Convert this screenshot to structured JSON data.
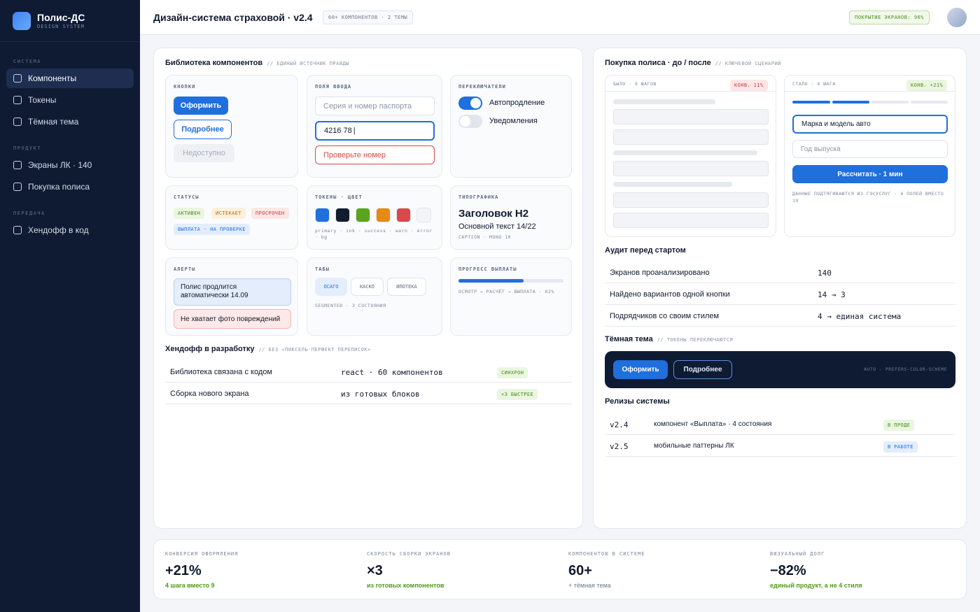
{
  "brand": {
    "name": "Полис-ДС",
    "subtitle": "DESIGN SYSTEM"
  },
  "sidebar": {
    "sections": [
      {
        "title": "СИСТЕМА",
        "items": [
          {
            "label": "Компоненты",
            "active": true
          },
          {
            "label": "Токены"
          },
          {
            "label": "Тёмная тема"
          }
        ]
      },
      {
        "title": "ПРОДУКТ",
        "items": [
          {
            "label": "Экраны ЛК · 140"
          },
          {
            "label": "Покупка полиса"
          }
        ]
      },
      {
        "title": "ПЕРЕДАЧА",
        "items": [
          {
            "label": "Хендофф в код"
          }
        ]
      }
    ]
  },
  "header": {
    "title": "Дизайн-система страховой · v2.4",
    "tag": "60+ КОМПОНЕНТОВ · 2 ТЕМЫ",
    "coverage": "ПОКРЫТИЕ ЭКРАНОВ: 96%"
  },
  "library": {
    "title": "Библиотека компонентов",
    "subtitle": "// ЕДИНЫЙ ИСТОЧНИК ПРАВДЫ",
    "buttons": {
      "label": "КНОПКИ",
      "primary": "Оформить",
      "secondary": "Подробнее",
      "disabled": "Недоступно"
    },
    "inputs": {
      "label": "ПОЛЯ ВВОДА",
      "placeholder": "Серия и номер паспорта",
      "value": "4216 78",
      "error": "Проверьте номер"
    },
    "toggles": {
      "label": "ПЕРЕКЛЮЧАТЕЛИ",
      "on": "Автопродление",
      "off": "Уведомления"
    },
    "statuses": {
      "label": "СТАТУСЫ",
      "active": "АКТИВЕН",
      "expiring": "ИСТЕКАЕТ",
      "expired": "ПРОСРОЧЕН",
      "payout": "ВЫПЛАТА · НА ПРОВЕРКЕ"
    },
    "tokens": {
      "label": "ТОКЕНЫ · ЦВЕТ",
      "colors": [
        "#1f6fdc",
        "#121c30",
        "#5aa51c",
        "#e68a12",
        "#d9484a",
        "#f3f4f6"
      ],
      "caption": "primary · ink · success · warn · error · bg"
    },
    "typography": {
      "label": "ТИПОГРАФИКА",
      "heading": "Заголовок H2",
      "body": "Основной текст 14/22",
      "caption": "CAPTION · MONO 10"
    },
    "alerts": {
      "label": "АЛЕРТЫ",
      "info": "Полис продлится автоматически 14.09",
      "error": "Не хватает фото повреждений"
    },
    "tabs": {
      "label": "ТАБЫ",
      "items": [
        "ОСАГО",
        "КАСКО",
        "ИПОТЕКА"
      ],
      "caption": "SEGMENTED · 3 СОСТОЯНИЯ"
    },
    "progress": {
      "label": "ПРОГРЕСС ВЫПЛАТЫ",
      "value": 0.62,
      "caption": "ОСМОТР → РАСЧЁТ → ВЫПЛАТА · 62%"
    }
  },
  "handoff": {
    "title": "Хендофф в разработку",
    "subtitle": "// БЕЗ «ПИКСЕЛЬ-ПЕРФЕКТ ПЕРЕПИСОК»",
    "rows": [
      {
        "name": "Библиотека связана с кодом",
        "value": "react · 60 компонентов",
        "badge": "СИНХРОН"
      },
      {
        "name": "Сборка нового экрана",
        "value": "из готовых блоков",
        "badge": "×3 БЫСТРЕЕ"
      }
    ]
  },
  "purchase": {
    "title": "Покупка полиса · до / после",
    "subtitle": "// КЛЮЧЕВОЙ СЦЕНАРИЙ",
    "before": {
      "label": "БЫЛО · 9 ШАГОВ",
      "badge": "КОНВ. 11%"
    },
    "after": {
      "label": "СТАЛО · 4 ШАГА",
      "badge": "КОНВ. +21%",
      "field1": "Марка и модель авто",
      "field2": "Год выпуска",
      "button": "Рассчитать · 1 мин",
      "note": "ДАННЫЕ ПОДТЯГИВАЮТСЯ ИЗ ГОСУСЛУГ · 6 ПОЛЕЙ ВМЕСТО 19"
    }
  },
  "audit": {
    "title": "Аудит перед стартом",
    "rows": [
      {
        "name": "Экранов проанализировано",
        "value": "140"
      },
      {
        "name": "Найдено вариантов одной кнопки",
        "value": "14 → 3"
      },
      {
        "name": "Подрядчиков со своим стилем",
        "value": "4 → единая система"
      }
    ]
  },
  "dark": {
    "title": "Тёмная тема",
    "subtitle": "// ТОКЕНЫ ПЕРЕКЛЮЧАЮТСЯ",
    "primary": "Оформить",
    "secondary": "Подробнее",
    "note": "AUTO · PREFERS-COLOR-SCHEME"
  },
  "releases": {
    "title": "Релизы системы",
    "rows": [
      {
        "version": "v2.4",
        "desc": "компонент «Выплата» · 4 состояния",
        "badge": "В ПРОДЕ"
      },
      {
        "version": "v2.5",
        "desc": "мобильные паттерны ЛК",
        "badge": "В РАБОТЕ"
      }
    ]
  },
  "kpis": [
    {
      "label": "КОНВЕРСИЯ ОФОРМЛЕНИЯ",
      "value": "+21%",
      "note": "4 шага вместо 9"
    },
    {
      "label": "СКОРОСТЬ СБОРКИ ЭКРАНОВ",
      "value": "×3",
      "note": "из готовых компонентов"
    },
    {
      "label": "КОМПОНЕНТОВ В СИСТЕМЕ",
      "value": "60+",
      "note": "+ тёмная тема"
    },
    {
      "label": "ВИЗУАЛЬНЫЙ ДОЛГ",
      "value": "−82%",
      "note": "единый продукт, а не 4 стиля"
    }
  ]
}
